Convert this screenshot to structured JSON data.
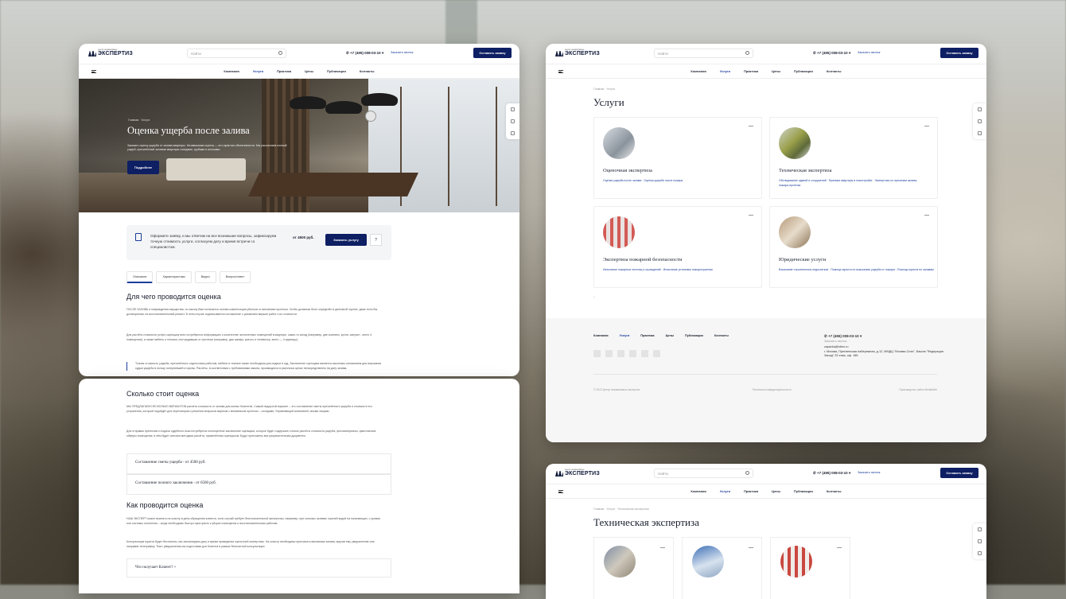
{
  "header": {
    "logo_small": "центр независимых",
    "logo_big": "ЭКСПЕРТИЗ",
    "search_placeholder": "Найти",
    "phone": "+7 (495) 008-03-10",
    "callback": "Заказать звонок",
    "cta": "Оставить заявку",
    "nav": [
      "Компания",
      "Услуги",
      "Практика",
      "Цены",
      "Публикации",
      "Контакты"
    ]
  },
  "page1": {
    "breadcrumb": "Главная · Услуги",
    "hero_title": "Оценка ущерба после залива",
    "hero_sub": "Заказать оценку ущерба от залива квартиры. Независимая оценка — это гарантия объективности. Мы рассчитаем полный ущерб, причинённый заливом квартиры соседями, трубами и потоками.",
    "hero_button": "Подробнее",
    "cta_text": "Оформите заявку, и мы ответим на все возникшие вопросы, зафиксируем точную стоимость услуги, согласуем дату и время встречи со специалистом.",
    "cta_price": "от 4500 руб.",
    "cta_button": "Заказать услугу",
    "cta_q": "?",
    "tabs": [
      "Описание",
      "Характеристики",
      "Видео",
      "Вопрос/ответ"
    ],
    "h_why": "Для чего проводится оценка",
    "p_why1": "ПОСЛЕ ЗАЛИВА и повреждения имущества, по закону Вам полагается полная компенсация убытков от виновника протечки. Чтобы должным быть определён в денежной оценке, даже если Вы договорились на восстановительный ремонт. В этом случае подписывается соглашение с указанием вершин работ и их стоимости.",
    "p_why2": "Для расчёта стоимости услуги оценщику всех потребуются информацию о количестве затопленных помещений в квартире, какие-то склад (например, две комнаты, кухня, санузел - всего 4 помещения), а также мебель и техника, пострадавшая от протечки (например, два шкафа, кресло и телевизор, всего — 4 единицы).",
    "quote": "Точная стоимость ущерба, причинённого отделочным работам, мебели и технике также необходима для подачи в суд. Заключение оценщика является законным основанием для взыскания судом ущерба в пользу потерпевшей стороны. Расчёты, в соответствии с требованиями закона, производятся в рыночных ценах непосредственно на дату залива.",
    "h_cost": "Сколько стоит оценка",
    "p_cost1": "МЫ ПРЕДЛАГАЕМ НЕСКОЛЬКО ВАРИАНТОВ расчёта стоимости от залива для жилых Клиентов. Самый недорогой вариант – это составление сметы причинённого ущерба и стоимости его устранения, который подойдёт для переговоров и решения вопросов мирным с виновником протечки – соседями, Управляющей компанией, иными лицами.",
    "p_cost2": "Для отправки претензии и подачи судебного иска потребуется полноценное заключение оценщика, которое будет содержать точные расчёты стоимости ущерба, фотоматериалы, фактические обмеры помещения, в нём будет описана методика расчёта, применённая оценщиком. Будут приложены вся разрешительная документы.",
    "acc1": "Составление сметы ущерба - от 4500 руб.",
    "acc2": "Составление полного заключения - от 6500 руб.",
    "h_how": "Как проводится оценка",
    "p_how1": "НАШ ЭКСПЕРТ может выехать на осмотр в день обращения клиента, если случай требует безотлагательной экспертизы, например, при сильных заливах горячей водой на начинающих, с кровью или системы отопления – когда необходимо быстро приступить к уборке помещения и восстановительным работам.",
    "p_how2": "Консультация юриста будет бесплатны, мы запланируем дату и время проведения оценочной экспертизы. На осмотр необходимо пригласить виновника залива, вручив ему уведомление или направив телеграмму. Текст уведомления мы подготовим для Клиента в рамках бесплатной консультации.",
    "acc3": "Что получает Клиент? +"
  },
  "page2": {
    "breadcrumb": "Главная · Услуги",
    "title": "Услуги",
    "cards": [
      {
        "name": "Оценочная экспертиза",
        "links": "Оценка ущерба после залива · Оценка ущерба после пожара"
      },
      {
        "name": "Техническая экспертиза",
        "links": "Обследование зданий и сооружений · Приемка квартиры в новостройке · Экспертиза по причинам залива, пожара,протечки"
      },
      {
        "name": "Экспертиза пожарной безопасности",
        "links": "Испытание пожарных лестниц и ограждений · Испытание установок пожаротушения"
      },
      {
        "name": "Юридические услуги",
        "links": "Взыскание строительных недостатков · Помощь юриста по взысканию ущерба от пожара · Помощь юриста по заливам"
      }
    ],
    "dot": "·",
    "footer": {
      "nav": [
        "Компания",
        "Услуги",
        "Практика",
        "Цены",
        "Публикации",
        "Контакты"
      ],
      "phone": "+7 (495) 008-03-10",
      "callback": "Заказать звонок",
      "email": "zayavka@nbex.ru",
      "address": "г. Москва, Пресненская набережная, д.12, ММДЦ \"Москва-Сити\", Башня \"Федерация Запад\" 23 этаж, оф. 185",
      "copyright": "© 2023 Центр независимых экспертиз",
      "policy": "Политика конфиденциальности",
      "dev": "Производство сайта MediaWeb"
    }
  },
  "page3": {
    "breadcrumb": "Главная · Услуги · Техническая экспертиза",
    "title": "Техническая экспертиза"
  }
}
